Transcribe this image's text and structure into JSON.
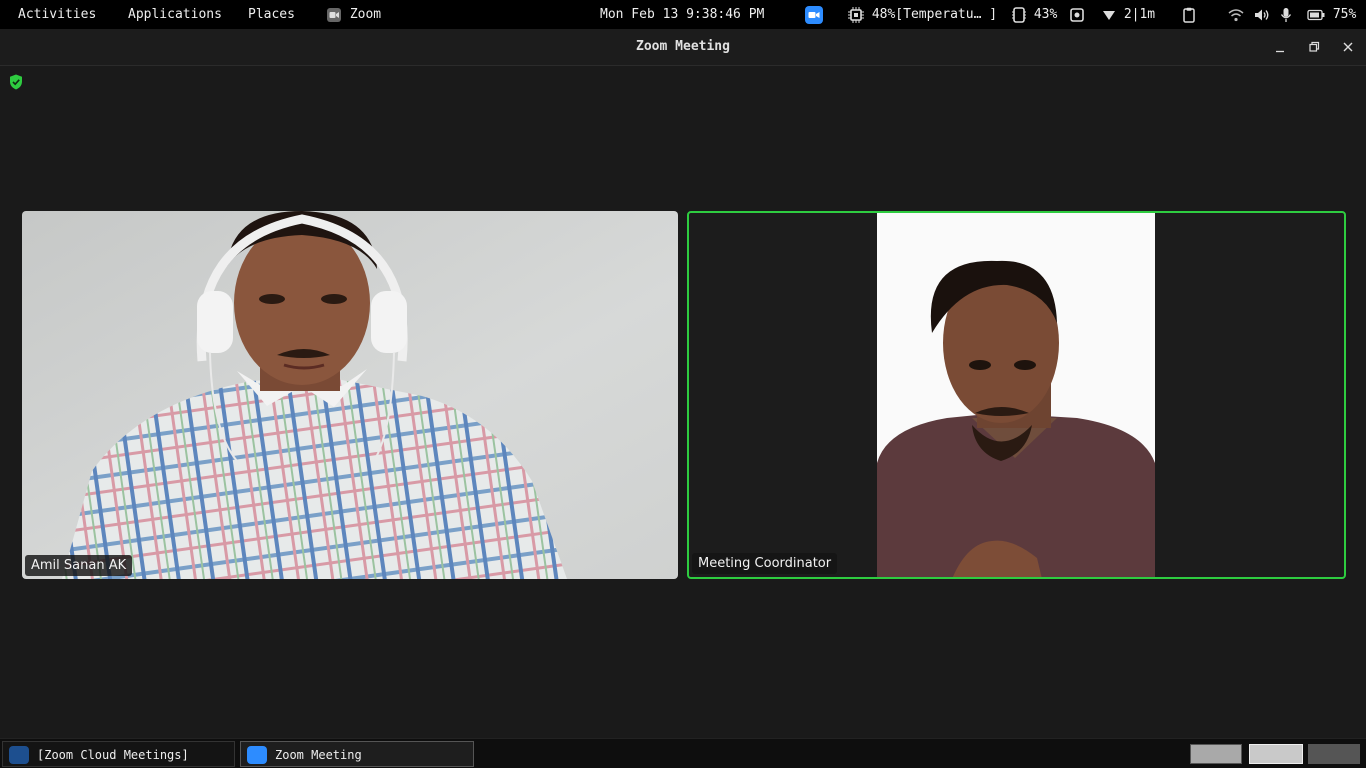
{
  "topbar": {
    "activities": "Activities",
    "applications": "Applications",
    "places": "Places",
    "app_name": "Zoom",
    "clock": "Mon Feb 13  9:38:46 PM",
    "cpu": "48%[Temperatu… ]",
    "memory": "43%",
    "network": "2|1m",
    "battery": "75%"
  },
  "window": {
    "title": "Zoom Meeting"
  },
  "participants": [
    {
      "name": "Amil Sanan AK",
      "active_speaker": false
    },
    {
      "name": "Meeting Coordinator",
      "active_speaker": true
    }
  ],
  "taskbar": {
    "tasks": [
      {
        "label": "[Zoom Cloud Meetings]"
      },
      {
        "label": "Zoom Meeting"
      }
    ],
    "workspace_count": 3,
    "active_workspace": 2
  },
  "colors": {
    "active_speaker_border": "#2ecc40",
    "shield": "#2ecc40",
    "zoom_blue": "#2d8cff"
  }
}
